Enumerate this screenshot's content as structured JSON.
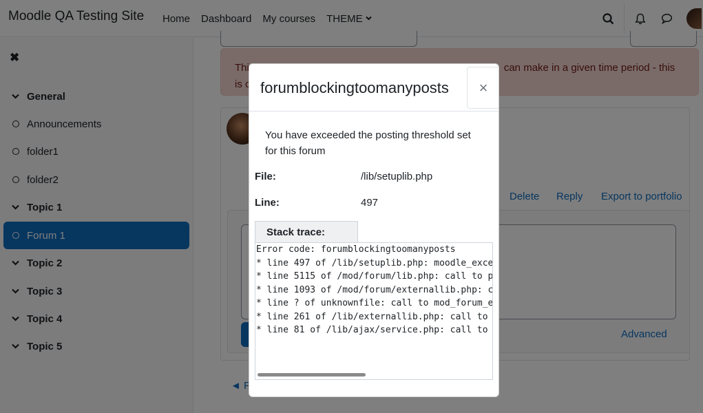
{
  "navbar": {
    "brand": "Moodle QA Testing Site",
    "links": [
      "Home",
      "Dashboard",
      "My courses",
      "THEME"
    ],
    "active_link": "My courses"
  },
  "sidebar": {
    "items": [
      {
        "label": "General",
        "type": "section"
      },
      {
        "label": "Announcements",
        "type": "activity"
      },
      {
        "label": "folder1",
        "type": "activity"
      },
      {
        "label": "folder2",
        "type": "activity"
      },
      {
        "label": "Topic 1",
        "type": "section"
      },
      {
        "label": "Forum 1",
        "type": "activity",
        "active": true
      },
      {
        "label": "Topic 2",
        "type": "section"
      },
      {
        "label": "Topic 3",
        "type": "section"
      },
      {
        "label": "Topic 4",
        "type": "section"
      },
      {
        "label": "Topic 5",
        "type": "section"
      }
    ]
  },
  "main": {
    "alert_line1_start": "Thi",
    "alert_line1_end": "can make in a given time period - this",
    "alert_line2_start": "is c",
    "actions": [
      "Delete",
      "Reply",
      "Export to portfolio"
    ],
    "advanced": "Advanced",
    "prev": "◄ P"
  },
  "modal": {
    "title": "forumblockingtoomanyposts",
    "close": "×",
    "message": "You have exceeded the posting threshold set for this forum",
    "file_label": "File:",
    "file_value": "/lib/setuplib.php",
    "line_label": "Line:",
    "line_value": "497",
    "stack_label": "Stack trace:",
    "stack_lines": [
      "Error code: forumblockingtoomanyposts",
      "* line 497 of /lib/setuplib.php: moodle_exce",
      "* line 5115 of /mod/forum/lib.php: call to p",
      "* line 1093 of /mod/forum/externallib.php: c",
      "* line ? of unknownfile: call to mod_forum_e",
      "* line 261 of /lib/externallib.php: call to ",
      "* line 81 of /lib/ajax/service.php: call to "
    ]
  }
}
